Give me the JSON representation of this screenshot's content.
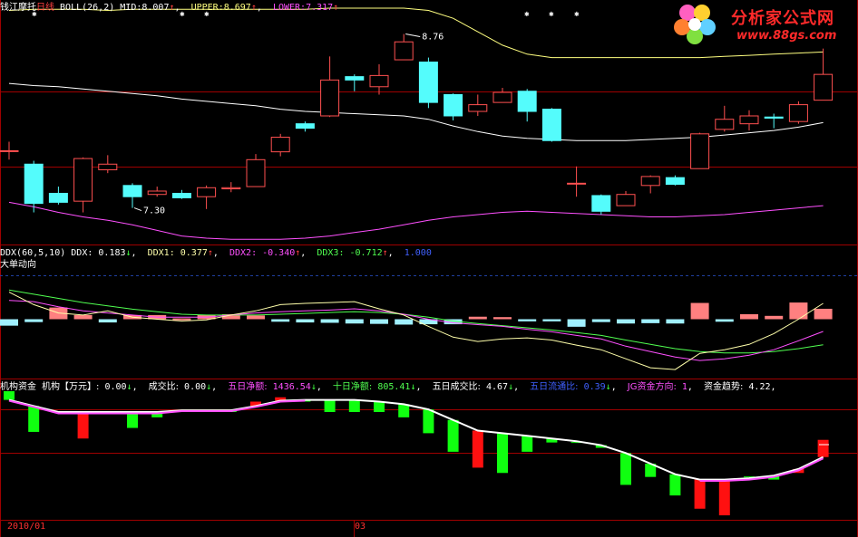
{
  "panel1": {
    "stock_name": "钱江摩托",
    "period": "日线",
    "indicator": "BOLL(26,2)",
    "mid_label": "MID:",
    "mid_value": "8.007",
    "upper_label": "UPPER:",
    "upper_value": "8.697",
    "lower_label": "LOWER:",
    "lower_value": "7.317",
    "arrow_up": "↑",
    "arrow_down": "↓",
    "high_annotation": "8.76",
    "low_annotation": "7.30"
  },
  "panel2": {
    "indicator": "DDX(60,5,10)",
    "ddx_label": "DDX:",
    "ddx_value": "0.183",
    "ddx1_label": "DDX1:",
    "ddx1_value": "0.377",
    "ddx2_label": "DDX2:",
    "ddx2_value": "-0.340",
    "ddx3_label": "DDX3:",
    "ddx3_value": "-0.712",
    "extra_value": "1.000",
    "subtitle": "大单动向"
  },
  "panel3": {
    "title": "机构资金",
    "jg_label": "机构【万元】:",
    "jg_value": "0.00",
    "cjb_label": "成交比:",
    "cjb_value": "0.00",
    "wrjje_label": "五日净额:",
    "wrjje_value": "1436.54",
    "srjje_label": "十日净额:",
    "srjje_value": "805.41",
    "wrcjb_label": "五日成交比:",
    "wrcjb_value": "4.67",
    "wrltb_label": "五日流通比:",
    "wrltb_value": "0.39",
    "jgfx_label": "JG资金方向:",
    "jgfx_value": "1",
    "zjqs_label": "资金趋势:",
    "zjqs_value": "4.22"
  },
  "dates": {
    "start": "2010/01",
    "mid": "03"
  },
  "logo": {
    "name": "分析家公式网",
    "url": "www.88gs.com"
  },
  "colors": {
    "up": "#ff5050",
    "down": "#54fcfc",
    "mid": "#ffffff",
    "upper": "#ffff80",
    "lower": "#ff50ff",
    "ddx_up": "#ff8080",
    "ddx_down": "#a0f0ff",
    "ddx_line1": "#ffffaa",
    "ddx_line2": "#ff50ff",
    "ddx_line3": "#50ff50",
    "inflow": "#ff1010",
    "outflow": "#10ff10",
    "trend": "#ff50ff",
    "trend2": "#ffffff",
    "grid": "#a00000"
  },
  "chart_data": [
    {
      "type": "candlestick",
      "title": "BOLL(26,2)",
      "ylim": [
        6.9,
        8.95
      ],
      "candles": [
        {
          "o": 7.72,
          "c": 7.72,
          "h": 7.8,
          "l": 7.64
        },
        {
          "o": 7.6,
          "c": 7.25,
          "h": 7.63,
          "l": 7.17
        },
        {
          "o": 7.34,
          "c": 7.26,
          "h": 7.4,
          "l": 7.24
        },
        {
          "o": 7.27,
          "c": 7.65,
          "h": 7.66,
          "l": 7.17
        },
        {
          "o": 7.55,
          "c": 7.6,
          "h": 7.68,
          "l": 7.52
        },
        {
          "o": 7.41,
          "c": 7.31,
          "h": 7.43,
          "l": 7.21
        },
        {
          "o": 7.33,
          "c": 7.36,
          "h": 7.4,
          "l": 7.31
        },
        {
          "o": 7.34,
          "c": 7.3,
          "h": 7.37,
          "l": 7.29
        },
        {
          "o": 7.31,
          "c": 7.39,
          "h": 7.41,
          "l": 7.2
        },
        {
          "o": 7.38,
          "c": 7.39,
          "h": 7.44,
          "l": 7.35
        },
        {
          "o": 7.4,
          "c": 7.64,
          "h": 7.69,
          "l": 7.4
        },
        {
          "o": 7.71,
          "c": 7.84,
          "h": 7.87,
          "l": 7.67
        },
        {
          "o": 7.96,
          "c": 7.92,
          "h": 7.98,
          "l": 7.89
        },
        {
          "o": 8.03,
          "c": 8.35,
          "h": 8.56,
          "l": 8.02
        },
        {
          "o": 8.38,
          "c": 8.35,
          "h": 8.4,
          "l": 8.25
        },
        {
          "o": 8.29,
          "c": 8.39,
          "h": 8.49,
          "l": 8.22
        },
        {
          "o": 8.53,
          "c": 8.69,
          "h": 8.76,
          "l": 8.53
        },
        {
          "o": 8.51,
          "c": 8.15,
          "h": 8.55,
          "l": 8.1
        },
        {
          "o": 8.22,
          "c": 8.03,
          "h": 8.23,
          "l": 7.99
        },
        {
          "o": 8.07,
          "c": 8.13,
          "h": 8.22,
          "l": 8.03
        },
        {
          "o": 8.15,
          "c": 8.24,
          "h": 8.28,
          "l": 8.15
        },
        {
          "o": 8.25,
          "c": 8.07,
          "h": 8.27,
          "l": 7.98
        },
        {
          "o": 8.09,
          "c": 7.81,
          "h": 8.1,
          "l": 7.8
        },
        {
          "o": 7.43,
          "c": 7.43,
          "h": 7.58,
          "l": 7.31
        },
        {
          "o": 7.32,
          "c": 7.18,
          "h": 7.33,
          "l": 7.15
        },
        {
          "o": 7.23,
          "c": 7.33,
          "h": 7.36,
          "l": 7.23
        },
        {
          "o": 7.41,
          "c": 7.49,
          "h": 7.5,
          "l": 7.34
        },
        {
          "o": 7.48,
          "c": 7.42,
          "h": 7.5,
          "l": 7.41
        },
        {
          "o": 7.56,
          "c": 7.87,
          "h": 7.88,
          "l": 7.56
        },
        {
          "o": 7.91,
          "c": 8.0,
          "h": 8.12,
          "l": 7.89
        },
        {
          "o": 7.96,
          "c": 8.03,
          "h": 8.08,
          "l": 7.9
        },
        {
          "o": 8.02,
          "c": 8.01,
          "h": 8.05,
          "l": 7.92
        },
        {
          "o": 7.98,
          "c": 8.13,
          "h": 8.16,
          "l": 7.96
        },
        {
          "o": 8.17,
          "c": 8.4,
          "h": 8.63,
          "l": 8.17
        }
      ],
      "mid": [
        8.32,
        8.3,
        8.29,
        8.27,
        8.25,
        8.23,
        8.21,
        8.18,
        8.16,
        8.14,
        8.12,
        8.09,
        8.07,
        8.06,
        8.05,
        8.04,
        8.03,
        8.0,
        7.94,
        7.89,
        7.85,
        7.83,
        7.82,
        7.81,
        7.81,
        7.81,
        7.82,
        7.83,
        7.84,
        7.86,
        7.88,
        7.9,
        7.93,
        7.97
      ],
      "upper": [
        8.97,
        8.98,
        8.98,
        8.98,
        8.97,
        8.98,
        8.98,
        8.98,
        8.98,
        8.98,
        8.98,
        8.98,
        8.98,
        8.99,
        8.99,
        8.99,
        8.99,
        8.97,
        8.9,
        8.78,
        8.66,
        8.58,
        8.55,
        8.55,
        8.55,
        8.55,
        8.55,
        8.55,
        8.55,
        8.56,
        8.57,
        8.58,
        8.59,
        8.6
      ],
      "lower": [
        7.26,
        7.22,
        7.17,
        7.13,
        7.1,
        7.06,
        7.01,
        6.96,
        6.94,
        6.93,
        6.93,
        6.93,
        6.94,
        6.96,
        6.99,
        7.02,
        7.06,
        7.1,
        7.13,
        7.15,
        7.17,
        7.18,
        7.17,
        7.16,
        7.15,
        7.14,
        7.13,
        7.13,
        7.14,
        7.15,
        7.17,
        7.19,
        7.21,
        7.23
      ]
    },
    {
      "type": "bar",
      "title": "DDX(60,5,10)",
      "ylim": [
        -1.6,
        1.4
      ],
      "values": [
        -0.18,
        -0.08,
        0.28,
        0.1,
        -0.09,
        0.1,
        0.1,
        0.02,
        0.1,
        0.12,
        0.09,
        -0.07,
        -0.09,
        -0.1,
        -0.12,
        -0.13,
        -0.15,
        -0.14,
        -0.14,
        0.06,
        0.05,
        -0.06,
        -0.06,
        -0.21,
        -0.08,
        -0.12,
        -0.11,
        -0.12,
        0.39,
        -0.07,
        0.12,
        0.08,
        0.4,
        0.25
      ],
      "series": [
        {
          "name": "DDX1",
          "values": [
            0.65,
            0.35,
            0.15,
            0.1,
            0.2,
            0.05,
            0.0,
            -0.05,
            -0.02,
            0.1,
            0.2,
            0.35,
            0.38,
            0.4,
            0.42,
            0.25,
            0.1,
            -0.2,
            -0.5,
            -0.62,
            -0.55,
            -0.52,
            -0.58,
            -0.72,
            -0.85,
            -1.1,
            -1.35,
            -1.4,
            -0.95,
            -0.85,
            -0.7,
            -0.4,
            0.0,
            0.38
          ]
        },
        {
          "name": "DDX2",
          "values": [
            0.45,
            0.42,
            0.3,
            0.2,
            0.15,
            0.1,
            0.05,
            0.05,
            0.05,
            0.1,
            0.15,
            0.18,
            0.2,
            0.22,
            0.25,
            0.2,
            0.12,
            0.0,
            -0.1,
            -0.15,
            -0.2,
            -0.28,
            -0.35,
            -0.45,
            -0.55,
            -0.75,
            -0.9,
            -1.05,
            -1.15,
            -1.1,
            -1.0,
            -0.85,
            -0.6,
            -0.34
          ]
        },
        {
          "name": "DDX3",
          "values": [
            0.7,
            0.6,
            0.5,
            0.4,
            0.32,
            0.24,
            0.18,
            0.12,
            0.1,
            0.1,
            0.1,
            0.12,
            0.14,
            0.16,
            0.18,
            0.16,
            0.12,
            0.05,
            -0.05,
            -0.12,
            -0.18,
            -0.24,
            -0.3,
            -0.37,
            -0.45,
            -0.58,
            -0.7,
            -0.82,
            -0.9,
            -0.94,
            -0.94,
            -0.9,
            -0.82,
            -0.71
          ]
        }
      ]
    },
    {
      "type": "bar",
      "title": "机构资金",
      "ylim": [
        -4,
        3.2
      ],
      "values": [
        1.2,
        -0.75,
        0.0,
        -1.0,
        0.0,
        -0.6,
        -0.2,
        0.0,
        0.0,
        0.0,
        0.6,
        0.85,
        0.6,
        0.0,
        0.0,
        0.0,
        -0.2,
        -0.8,
        -1.5,
        -2.1,
        -2.3,
        -1.5,
        -1.15,
        -1.15,
        -1.35,
        -2.75,
        -2.45,
        -3.15,
        -3.65,
        -3.9,
        -2.45,
        -2.55,
        -2.3,
        -1.05
      ],
      "series": [
        {
          "name": "trend",
          "values": [
            0.7,
            0.35,
            0.0,
            0.0,
            0.0,
            0.0,
            0.0,
            0.1,
            0.1,
            0.1,
            0.35,
            0.65,
            0.7,
            0.7,
            0.7,
            0.6,
            0.45,
            0.15,
            -0.3,
            -0.7,
            -0.8,
            -0.9,
            -1.0,
            -1.1,
            -1.25,
            -1.55,
            -1.95,
            -2.35,
            -2.55,
            -2.55,
            -2.5,
            -2.4,
            -2.15,
            -1.7
          ]
        }
      ]
    }
  ]
}
